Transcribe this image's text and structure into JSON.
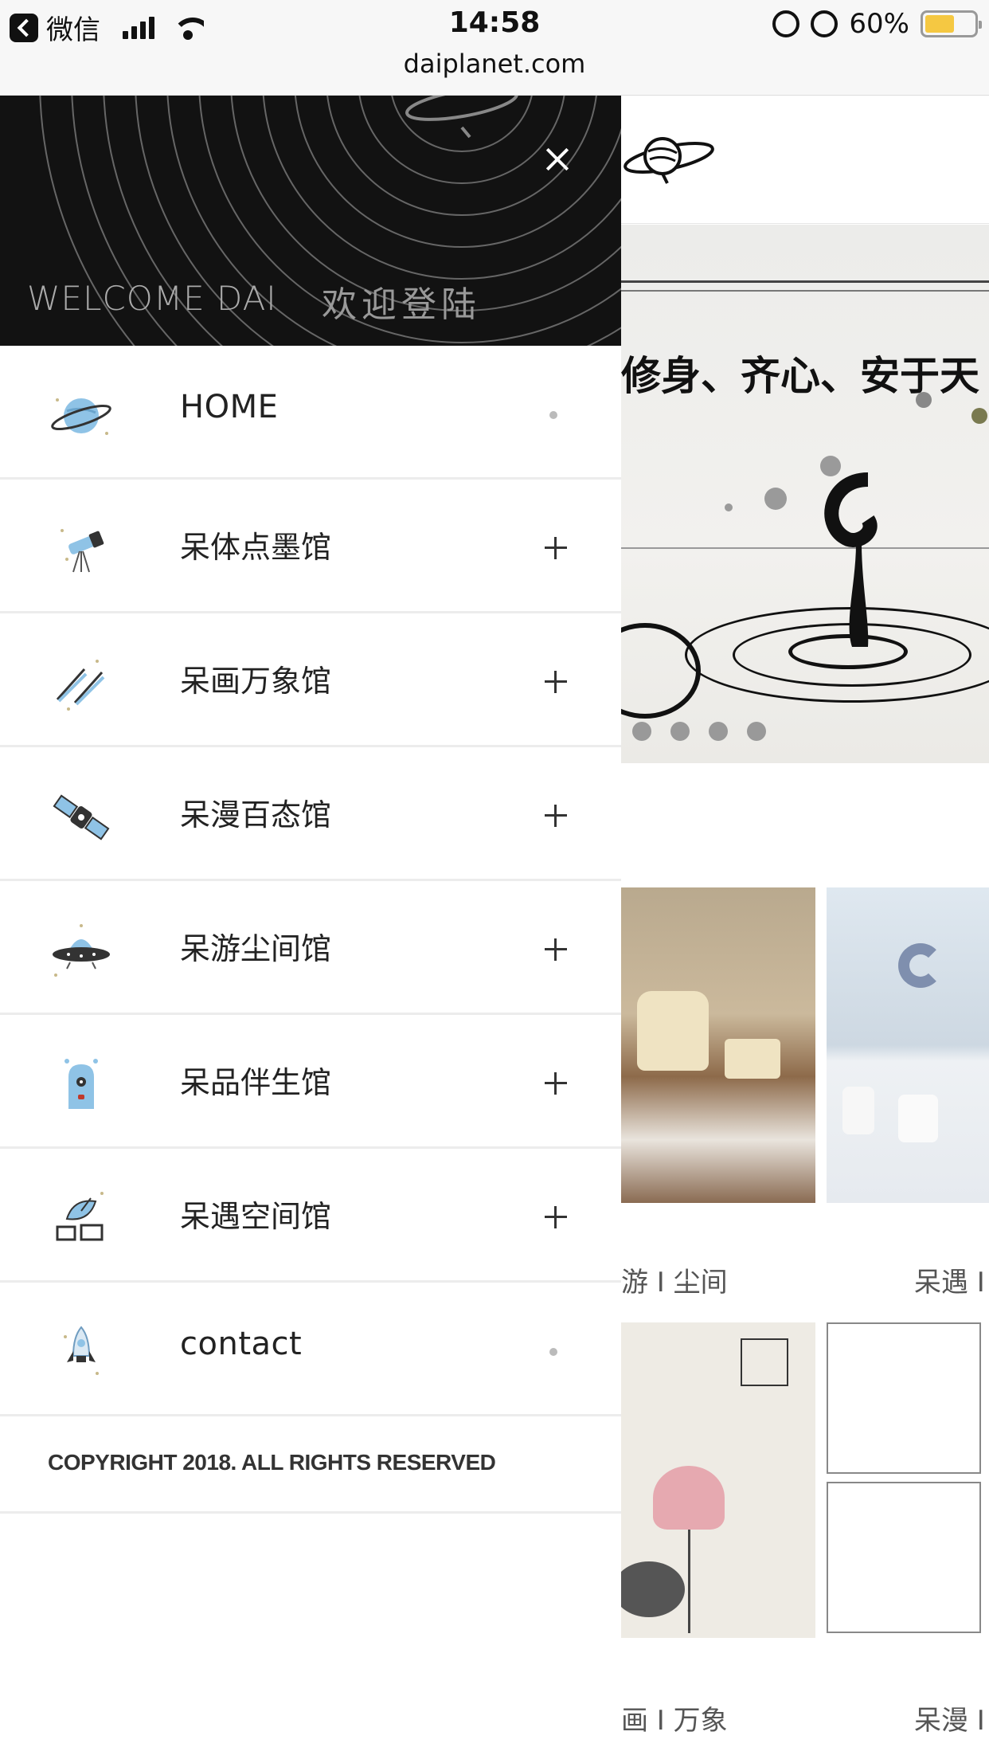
{
  "status_bar": {
    "back_app": "微信",
    "time": "14:58",
    "battery_percent_text": "60%",
    "battery_level": 0.6,
    "battery_color": "#f5c842"
  },
  "url_bar": {
    "domain": "daiplanet.com"
  },
  "drawer": {
    "welcome_en": "WELCOME DAI",
    "welcome_cn": "欢迎登陆",
    "close_icon": "close-icon",
    "menu": [
      {
        "label": "HOME",
        "icon": "saturn-planet-icon",
        "indicator": "dot"
      },
      {
        "label": "呆体点墨馆",
        "icon": "telescope-icon",
        "indicator": "plus"
      },
      {
        "label": "呆画万象馆",
        "icon": "comet-icon",
        "indicator": "plus"
      },
      {
        "label": "呆漫百态馆",
        "icon": "satellite-icon",
        "indicator": "plus"
      },
      {
        "label": "呆游尘间馆",
        "icon": "ufo-icon",
        "indicator": "plus"
      },
      {
        "label": "呆品伴生馆",
        "icon": "robot-icon",
        "indicator": "plus"
      },
      {
        "label": "呆遇空间馆",
        "icon": "radar-dish-icon",
        "indicator": "plus"
      },
      {
        "label": "contact",
        "icon": "rocket-icon",
        "indicator": "dot"
      }
    ],
    "copyright": "COPYRIGHT 2018. ALL RIGHTS RESERVED"
  },
  "background_page": {
    "banner_text": "修身、齐心、安于天",
    "banner_slide_count": 4,
    "captions": [
      "游 I 尘间",
      "呆遇 I",
      "画 I 万象",
      "呆漫 I"
    ]
  },
  "colors": {
    "drawer_header_bg": "#121212",
    "accent_blue": "#8fc3e6",
    "divider": "#ececec"
  }
}
